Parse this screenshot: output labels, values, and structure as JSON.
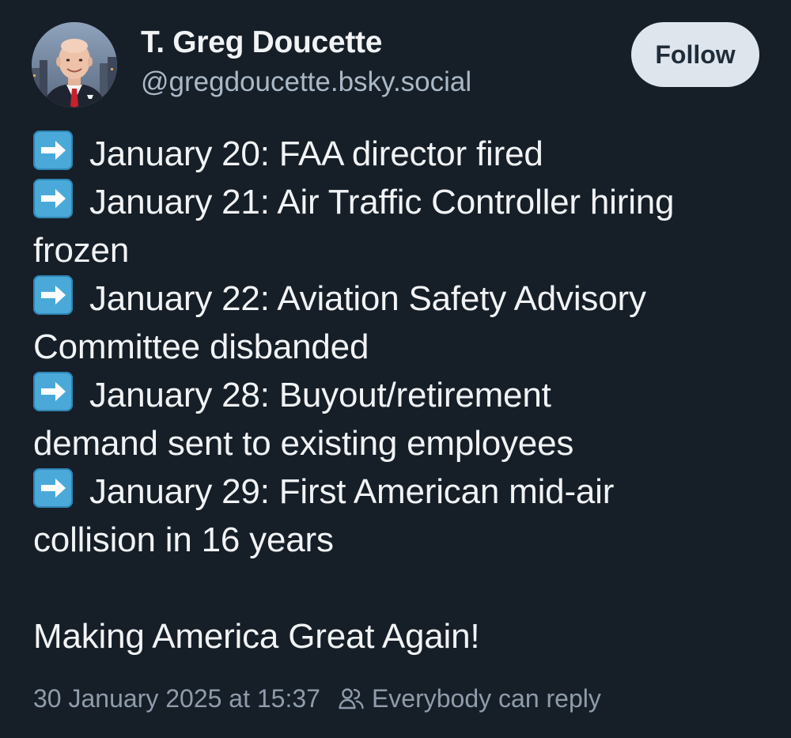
{
  "author": {
    "display_name": "T. Greg Doucette",
    "handle": "@gregdoucette.bsky.social",
    "avatar_icon": "profile-photo"
  },
  "actions": {
    "follow_label": "Follow"
  },
  "post": {
    "items": [
      {
        "icon": "right-arrow-emoji",
        "text": "January 20: FAA director fired"
      },
      {
        "icon": "right-arrow-emoji",
        "text": "January 21: Air Traffic Controller hiring",
        "cont": "frozen"
      },
      {
        "icon": "right-arrow-emoji",
        "text": "January 22: Aviation Safety Advisory",
        "cont": "Committee disbanded"
      },
      {
        "icon": "right-arrow-emoji",
        "text": "January 28: Buyout/retirement",
        "cont": "demand sent to existing employees"
      },
      {
        "icon": "right-arrow-emoji",
        "text": "January 29: First American mid-air",
        "cont": "collision in 16 years"
      }
    ],
    "closing": "Making America Great Again!"
  },
  "meta": {
    "timestamp": "30 January 2025 at 15:37",
    "reply_setting": "Everybody can reply",
    "reply_icon": "people-icon"
  },
  "colors": {
    "background": "#161e27",
    "text": "#f1f3f5",
    "secondary_text": "#aab8c7",
    "button_bg": "#dfe5ec",
    "arrow_emoji": "#4aa9d8"
  }
}
